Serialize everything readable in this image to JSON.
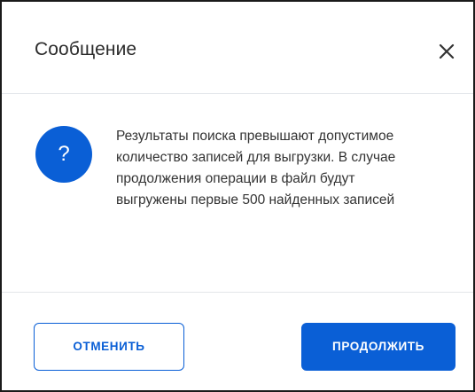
{
  "dialog": {
    "title": "Сообщение",
    "close_icon": "close-icon",
    "message": "Результаты поиска превышают допустимое количество записей для выгрузки. В случае продолжения операции в файл будут выгружены первые 500 найденных записей",
    "question_icon": {
      "glyph": "?",
      "name": "question-icon",
      "color": "#0a5fd6"
    },
    "buttons": {
      "cancel_label": "ОТМЕНИТЬ",
      "continue_label": "ПРОДОЛЖИТЬ"
    },
    "colors": {
      "accent": "#0a5fd6",
      "divider": "#e3e6ea",
      "text": "#333333"
    }
  }
}
